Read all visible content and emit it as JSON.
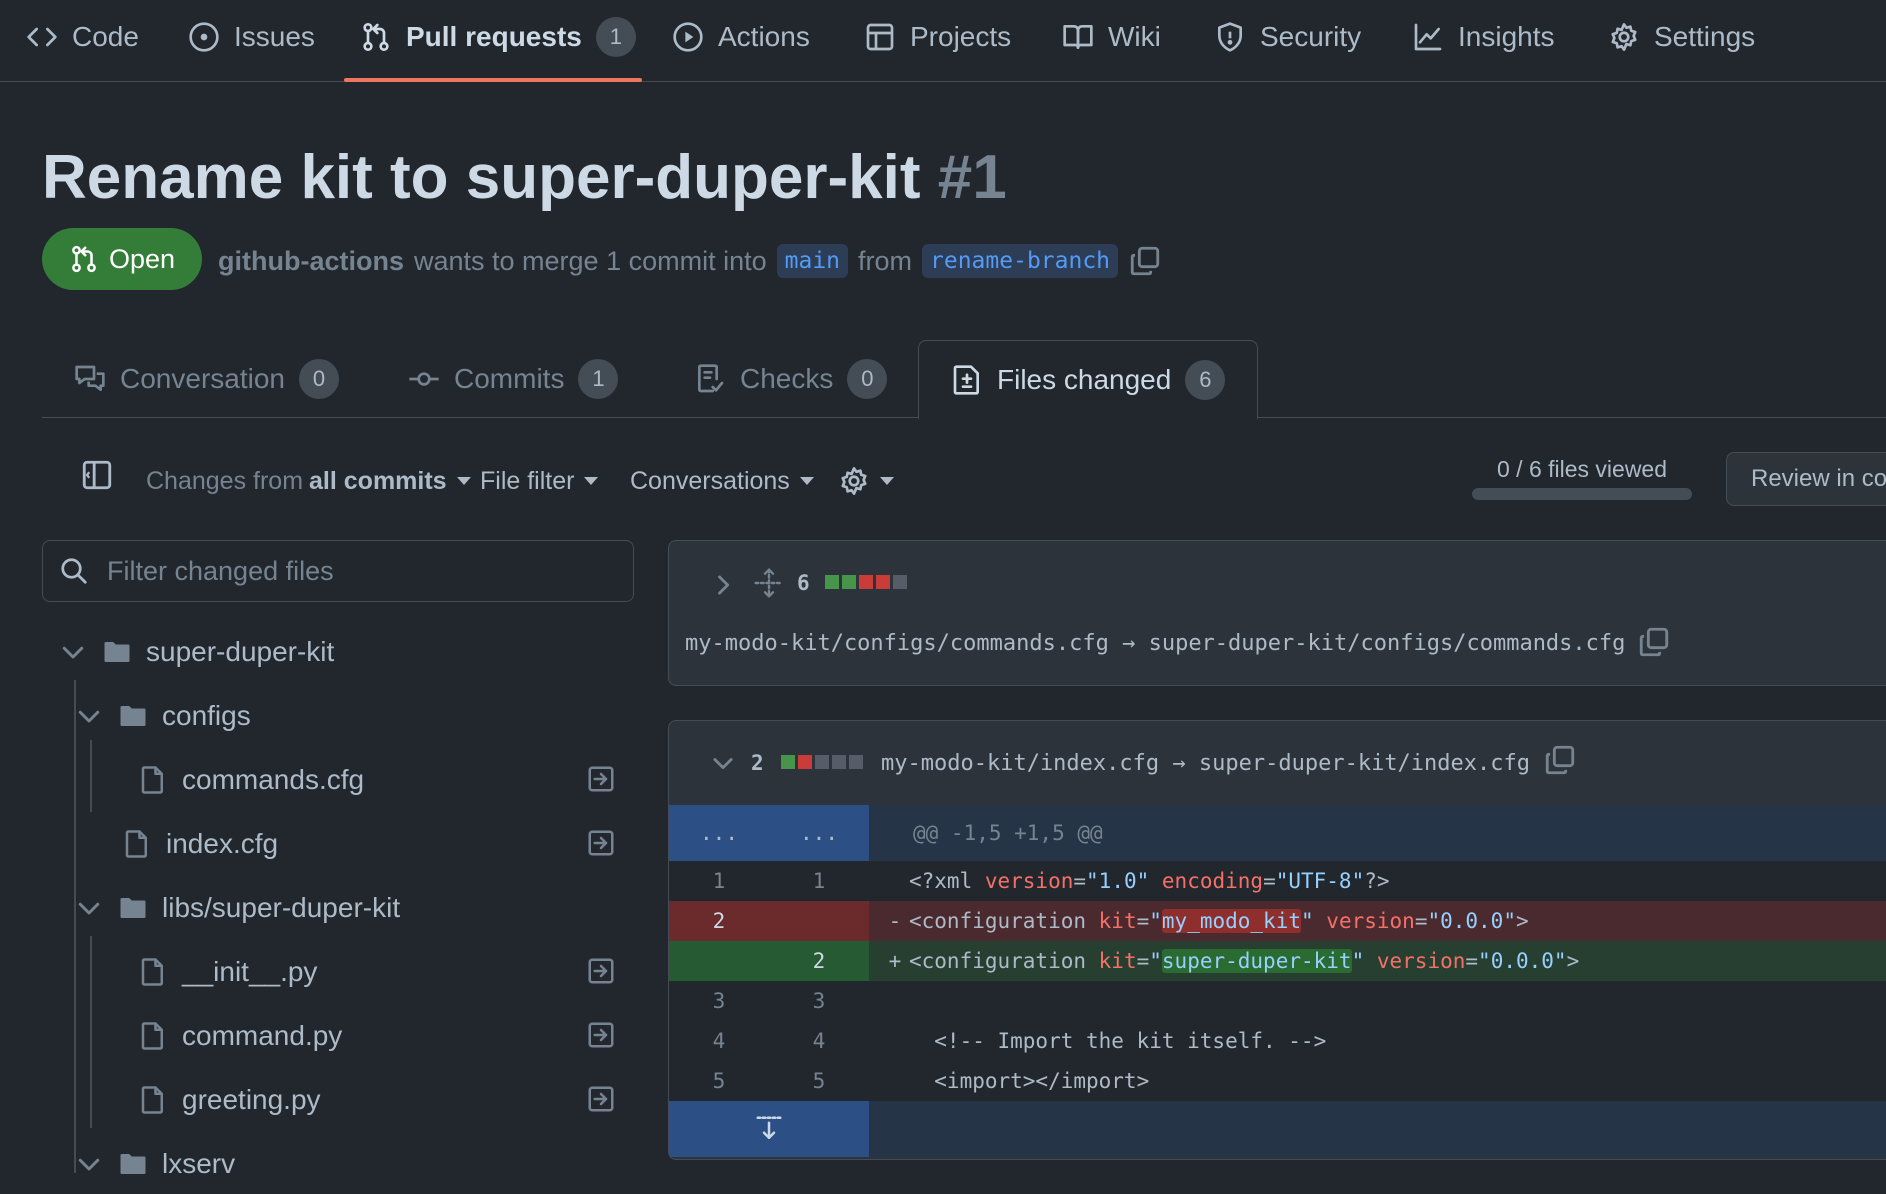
{
  "repo_nav": {
    "items": [
      {
        "label": "Code",
        "icon": "code-icon"
      },
      {
        "label": "Issues",
        "icon": "issue-opened-icon"
      },
      {
        "label": "Pull requests",
        "icon": "git-pull-request-icon",
        "count": "1",
        "active": true
      },
      {
        "label": "Actions",
        "icon": "play-icon"
      },
      {
        "label": "Projects",
        "icon": "table-icon"
      },
      {
        "label": "Wiki",
        "icon": "book-icon"
      },
      {
        "label": "Security",
        "icon": "shield-icon"
      },
      {
        "label": "Insights",
        "icon": "graph-icon"
      },
      {
        "label": "Settings",
        "icon": "gear-icon"
      }
    ]
  },
  "pr": {
    "title": "Rename kit to super-duper-kit",
    "number": "#1",
    "state": "Open",
    "author": "github-actions",
    "merge_text": "wants to merge 1 commit into",
    "base_branch": "main",
    "from_text": "from",
    "head_branch": "rename-branch"
  },
  "tabs": [
    {
      "label": "Conversation",
      "count": "0",
      "icon": "comment-discussion-icon"
    },
    {
      "label": "Commits",
      "count": "1",
      "icon": "git-commit-icon"
    },
    {
      "label": "Checks",
      "count": "0",
      "icon": "checklist-icon"
    },
    {
      "label": "Files changed",
      "count": "6",
      "icon": "file-diff-icon",
      "active": true
    }
  ],
  "toolbar": {
    "changes_prefix": "Changes from",
    "changes_value": "all commits",
    "file_filter": "File filter",
    "conversations": "Conversations",
    "files_viewed": "0 / 6 files viewed",
    "files_viewed_fraction": 0,
    "review_button": "Review in codespace"
  },
  "filter": {
    "placeholder": "Filter changed files"
  },
  "file_tree": [
    {
      "name": "super-duper-kit",
      "type": "folder",
      "expanded": true
    },
    {
      "name": "configs",
      "type": "folder",
      "expanded": true
    },
    {
      "name": "commands.cfg",
      "type": "file"
    },
    {
      "name": "index.cfg",
      "type": "file"
    },
    {
      "name": "libs/super-duper-kit",
      "type": "folder",
      "expanded": true
    },
    {
      "name": "__init__.py",
      "type": "file"
    },
    {
      "name": "command.py",
      "type": "file"
    },
    {
      "name": "greeting.py",
      "type": "file"
    },
    {
      "name": "lxserv",
      "type": "folder",
      "expanded": true
    }
  ],
  "files": [
    {
      "changes": "6",
      "diffstat": [
        "add",
        "add",
        "del",
        "del",
        "neutral"
      ],
      "path": "my-modo-kit/configs/commands.cfg → super-duper-kit/configs/commands.cfg",
      "expanded": false
    },
    {
      "changes": "2",
      "diffstat": [
        "add",
        "del",
        "neutral",
        "neutral",
        "neutral"
      ],
      "path": "my-modo-kit/index.cfg → super-duper-kit/index.cfg",
      "expanded": true,
      "hunk_placeholder": "...",
      "hunk_header": "@@ -1,5 +1,5 @@",
      "lines": [
        {
          "old": "1",
          "new": "1",
          "type": "ctx"
        },
        {
          "old": "2",
          "new": "",
          "type": "del"
        },
        {
          "old": "",
          "new": "2",
          "type": "add"
        },
        {
          "old": "3",
          "new": "3",
          "type": "ctx"
        },
        {
          "old": "4",
          "new": "4",
          "type": "ctx"
        },
        {
          "old": "5",
          "new": "5",
          "type": "ctx"
        }
      ],
      "code": {
        "l1_open": "<?xml ",
        "l1_attr1": "version",
        "l1_eq1": "=",
        "l1_val1": "\"1.0\"",
        "l1_sp": " ",
        "l1_attr2": "encoding",
        "l1_eq2": "=",
        "l1_val2": "\"UTF-8\"",
        "l1_close": "?>",
        "del_marker": "-",
        "add_marker": "+",
        "cfg_open": "<configuration ",
        "kit_attr": "kit",
        "eq": "=",
        "quote": "\"",
        "old_kit": "my_modo_kit",
        "new_kit": "super-duper-kit",
        "version_attr": "version",
        "version_val": "\"0.0.0\"",
        "tag_close": ">",
        "l4": "  <!-- Import the kit itself. -->",
        "l5": "  <import></import>"
      }
    }
  ],
  "colors": {
    "background": "#22272e",
    "open_badge": "#347d39",
    "active_underline": "#ec775c",
    "diff_add": "#2b4a34",
    "diff_del": "#5a2e33",
    "hunk": "#2c3e5c"
  }
}
